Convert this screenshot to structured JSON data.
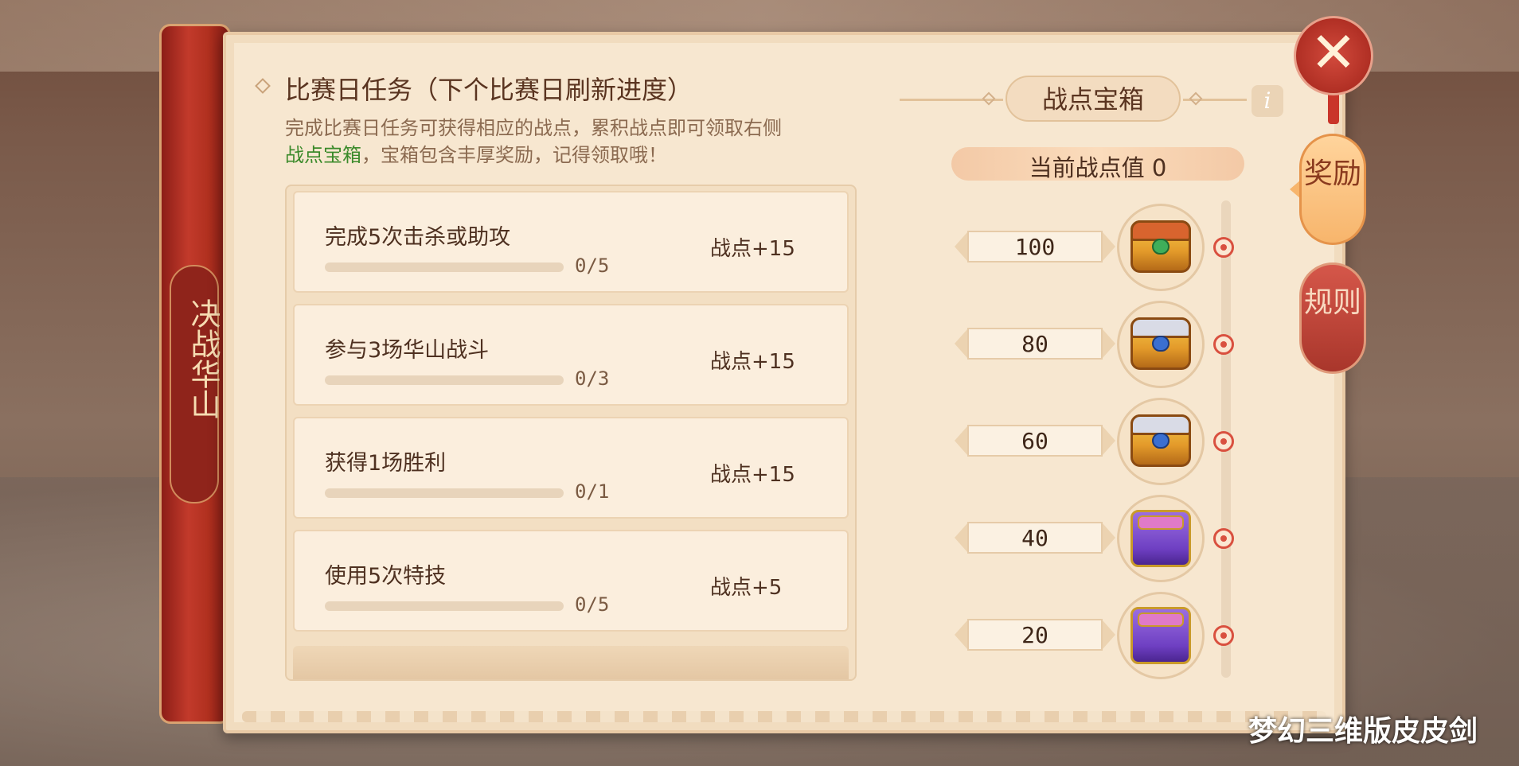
{
  "side_title": "决战华山",
  "header": {
    "title": "比赛日任务（下个比赛日刷新进度）",
    "desc_part1": "完成比赛日任务可获得相应的战点，累积战点即可领取右侧",
    "desc_green": "战点宝箱",
    "desc_part2": "，宝箱包含丰厚奖励，记得领取哦！"
  },
  "tasks": [
    {
      "name": "完成5次击杀或助攻",
      "progress": "0/5",
      "progress_fraction": 0,
      "reward": "战点+15"
    },
    {
      "name": "参与3场华山战斗",
      "progress": "0/3",
      "progress_fraction": 0,
      "reward": "战点+15"
    },
    {
      "name": "获得1场胜利",
      "progress": "0/1",
      "progress_fraction": 0,
      "reward": "战点+15"
    },
    {
      "name": "使用5次特技",
      "progress": "0/5",
      "progress_fraction": 0,
      "reward": "战点+5"
    }
  ],
  "chest_panel": {
    "title": "战点宝箱",
    "info_icon": "i",
    "points_label": "当前战点值  0",
    "milestones": [
      {
        "value": "100",
        "chest_icon": "gold-red-chest-icon"
      },
      {
        "value": "80",
        "chest_icon": "gold-blue-chest-icon"
      },
      {
        "value": "60",
        "chest_icon": "gold-blue-chest-icon"
      },
      {
        "value": "40",
        "chest_icon": "purple-chest-icon"
      },
      {
        "value": "20",
        "chest_icon": "purple-chest-icon"
      }
    ]
  },
  "side_tabs": {
    "reward": "奖励",
    "rules": "规则"
  },
  "close_label": "✕",
  "watermark": "梦幻三维版皮皮剑",
  "colors": {
    "accent_red": "#b0301f",
    "highlight_green": "#3b8a2a",
    "panel_bg": "#f7e7d0"
  }
}
